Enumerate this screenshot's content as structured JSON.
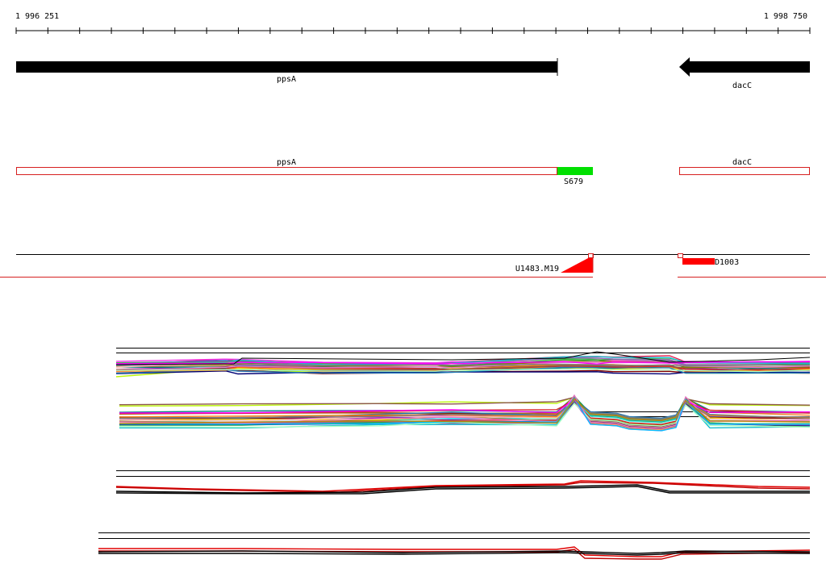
{
  "coordinates": {
    "start_label": "1 996 251",
    "end_label": "1 998 750",
    "start": 1996251,
    "end": 1998750
  },
  "genes": [
    {
      "name": "ppsA",
      "strand": "+",
      "start": 1996251,
      "end": 1997955
    },
    {
      "name": "dacC",
      "strand": "-",
      "start": 1998340,
      "end": 1998750
    }
  ],
  "annotations": [
    {
      "name": "ppsA",
      "kind": "gene",
      "start": 1996251,
      "end": 1997955
    },
    {
      "name": "S679",
      "kind": "segment",
      "start": 1997955,
      "end": 1998065
    },
    {
      "name": "dacC",
      "kind": "gene",
      "start": 1998340,
      "end": 1998750
    }
  ],
  "features": [
    {
      "name": "U1483.M19",
      "shape": "ramp",
      "start": 1997870,
      "end": 1998065,
      "color": "#ff0000"
    },
    {
      "name": "D1003",
      "shape": "bar",
      "start": 1998350,
      "end": 1998455,
      "color": "#ff0000"
    }
  ],
  "colors": {
    "gene": "#000000",
    "annotation_outline": "#d62020",
    "segment": "#00e000",
    "feature": "#ff0000",
    "divider": "#d62020",
    "series_palette": [
      "#e6194b",
      "#3cb44b",
      "#4363d8",
      "#f58231",
      "#911eb4",
      "#46f0f0",
      "#f032e6",
      "#bcf60c",
      "#008080",
      "#9a6324",
      "#800000",
      "#808000",
      "#000075",
      "#ffe119",
      "#fabebe",
      "#1f77b4",
      "#ff7f0e",
      "#2ca02c",
      "#d62728",
      "#9467bd",
      "#8c564b",
      "#e377c2",
      "#17becf",
      "#7f7f7f",
      "#aaffc3",
      "#ff00ff",
      "#00bfff",
      "#b8860b"
    ]
  }
}
